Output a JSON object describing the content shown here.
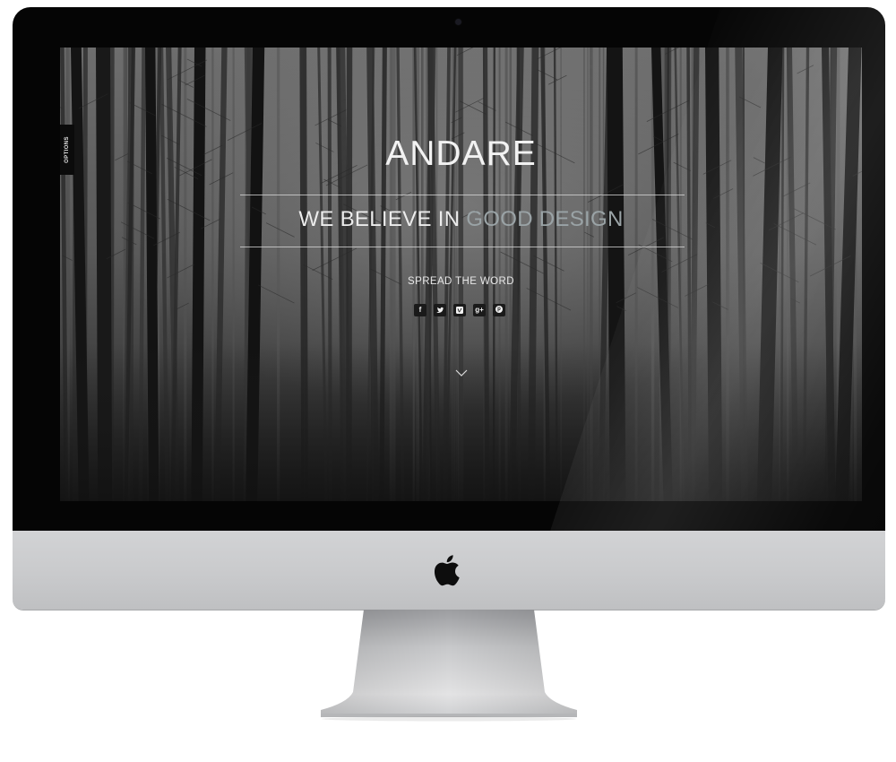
{
  "site": {
    "options_label": "OPTIONS",
    "brand_title": "ANDARE",
    "tagline_prefix": "WE BELIEVE IN ",
    "tagline_accent": "GOOD DESIGN",
    "spread_label": "SPREAD THE WORD",
    "social": [
      {
        "icon": "facebook-icon",
        "glyph": "f"
      },
      {
        "icon": "twitter-icon",
        "glyph": "t"
      },
      {
        "icon": "vimeo-icon",
        "glyph": "v"
      },
      {
        "icon": "google-plus-icon",
        "glyph": "g+"
      },
      {
        "icon": "pinterest-icon",
        "glyph": "p"
      }
    ]
  },
  "colors": {
    "bezel": "#050505",
    "tagline_accent": "#9aa3a6",
    "body_aluminum": "#c9cacc",
    "background": "#ffffff"
  }
}
